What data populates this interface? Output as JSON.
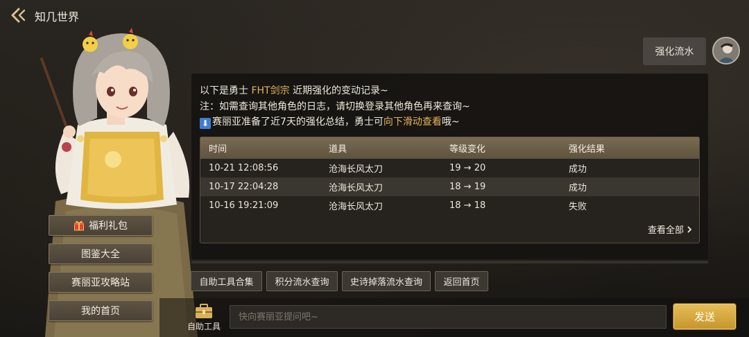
{
  "header": {
    "title": "知几世界",
    "back_icon": "back-arrow-icon"
  },
  "sidebar": {
    "buttons": [
      {
        "label": "福利礼包",
        "icon": "gift-icon"
      },
      {
        "label": "图鉴大全"
      },
      {
        "label": "赛丽亚攻略站"
      },
      {
        "label": "我的首页"
      }
    ]
  },
  "chat": {
    "user_message": "强化流水",
    "reply": {
      "line1_prefix": "以下是勇士 ",
      "line1_name": "FHT剑宗",
      "line1_suffix": " 近期强化的变动记录~",
      "line2": "注：如需查询其他角色的日志，请切换登录其他角色再来查询~",
      "line3_icon": "⬇",
      "line3_prefix": "赛丽亚准备了近7天的强化总结，勇士可",
      "line3_highlight": "向下滑动查看",
      "line3_suffix": "哦~"
    },
    "records": {
      "columns": [
        "时间",
        "道具",
        "等级变化",
        "强化结果"
      ],
      "rows": [
        {
          "time": "10-21 12:08:56",
          "item": "沧海长风太刀",
          "level": "19 → 20",
          "result": "成功"
        },
        {
          "time": "10-17 22:04:28",
          "item": "沧海长风太刀",
          "level": "18 → 19",
          "result": "成功"
        },
        {
          "time": "10-16 19:21:09",
          "item": "沧海长风太刀",
          "level": "18 → 18",
          "result": "失败"
        }
      ],
      "view_all": "查看全部",
      "view_all_icon": "chevron-right-icon"
    }
  },
  "quick_tools": [
    "自助工具合集",
    "积分流水查询",
    "史诗掉落流水查询",
    "返回首页"
  ],
  "composer": {
    "toolbox_label": "自助工具",
    "toolbox_icon": "toolbox-icon",
    "placeholder": "快向赛丽亚提问吧~",
    "value": "",
    "send_label": "发送"
  },
  "colors": {
    "accent_gold": "#e3b45a",
    "send_button": "#d6a83f",
    "background": "#1f1c18"
  }
}
